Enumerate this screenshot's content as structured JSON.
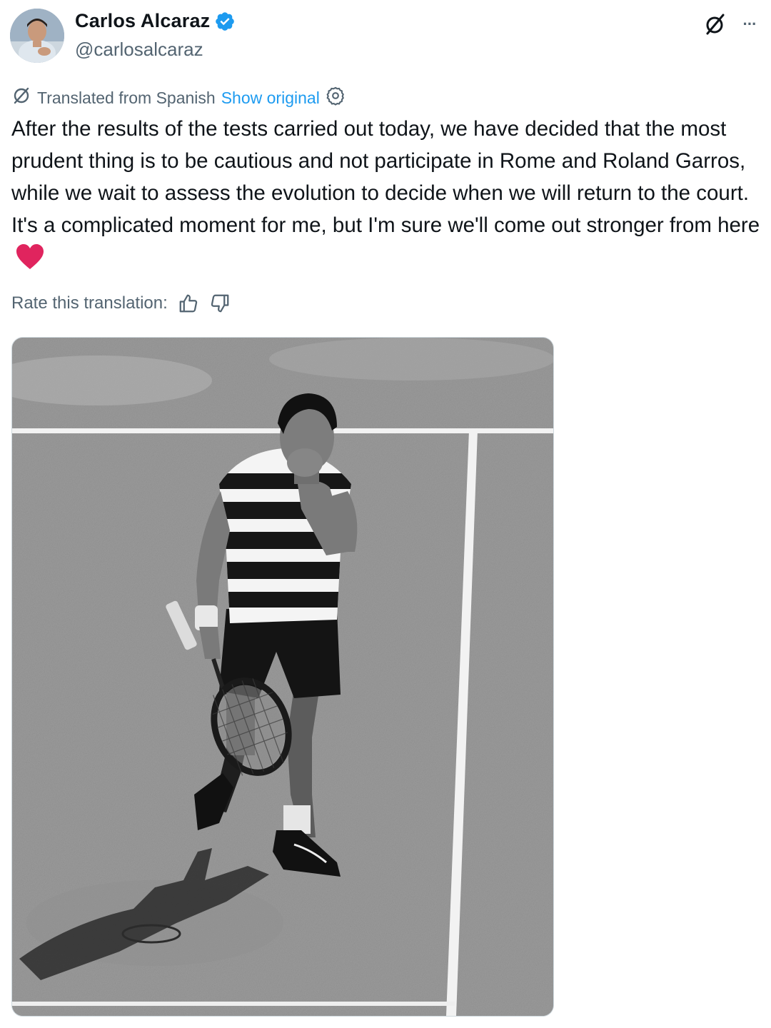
{
  "author": {
    "display_name": "Carlos Alcaraz",
    "handle": "@carlosalcaraz",
    "verified": true,
    "avatar_icon": "profile-photo"
  },
  "actions": {
    "grok_icon": "grok-icon",
    "more_icon": "more-icon",
    "more_label": "···"
  },
  "translation": {
    "label": "Translated from Spanish",
    "show_original": "Show original",
    "settings_icon": "gear-icon"
  },
  "tweet": {
    "text": "After the results of the tests carried out today, we have decided that the most prudent thing is to be cautious and not participate in Rome and Roland Garros, while we wait to assess the evolution to decide when we will return to the court. It's a complicated moment for me, but I'm sure we'll come out stronger from here",
    "emoji": "red-heart-emoji"
  },
  "rate": {
    "label": "Rate this translation:",
    "thumbs_up_icon": "thumbs-up-icon",
    "thumbs_down_icon": "thumbs-down-icon"
  },
  "media": {
    "alt": "Black and white photo of a tennis player in a striped shirt on a clay court, hand to face, holding a racket"
  },
  "colors": {
    "text": "#0f1419",
    "secondary": "#536471",
    "accent": "#1d9bf0",
    "heart": "#e0245e"
  }
}
